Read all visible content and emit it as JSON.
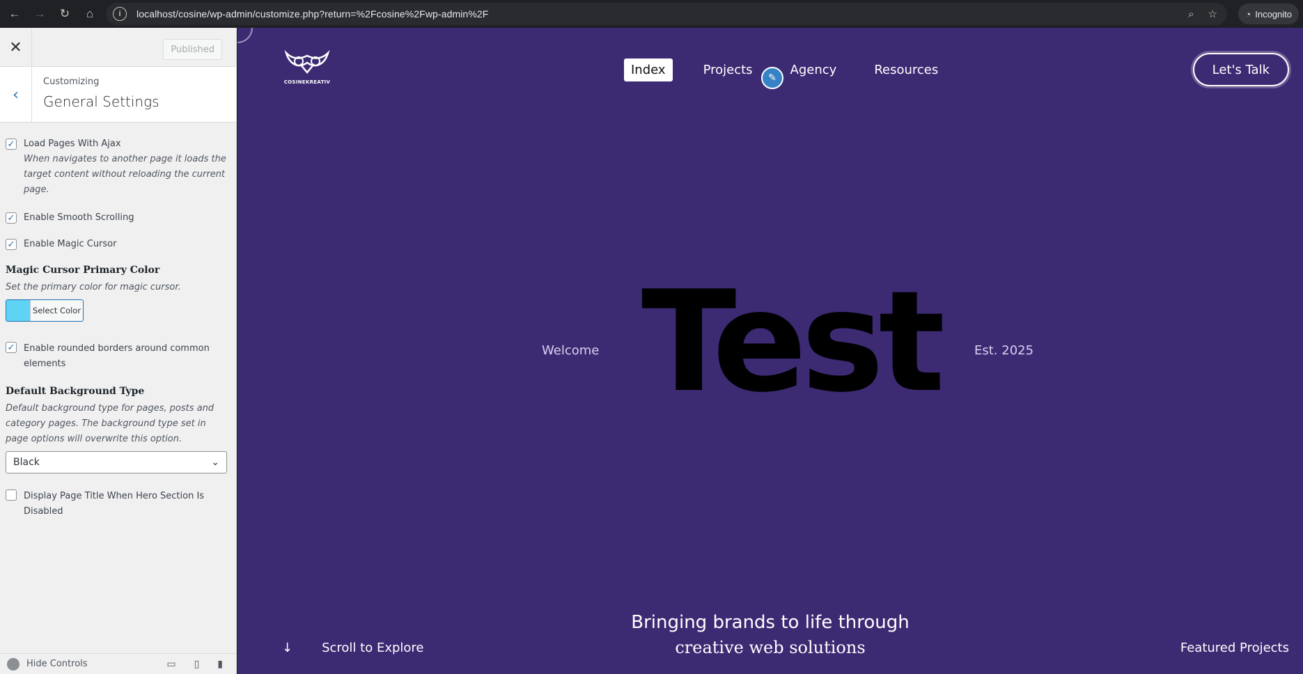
{
  "browser": {
    "url": "localhost/cosine/wp-admin/customize.php?return=%2Fcosine%2Fwp-admin%2F",
    "incognito_label": "Incognito"
  },
  "customizer": {
    "published_label": "Published",
    "customizing_label": "Customizing",
    "section_title": "General Settings",
    "options": {
      "ajax_label": "Load Pages With Ajax",
      "ajax_desc": "When navigates to another page it loads the target content without reloading the current page.",
      "smooth_label": "Enable Smooth Scrolling",
      "cursor_label": "Enable Magic Cursor",
      "cursor_color_heading": "Magic Cursor Primary Color",
      "cursor_color_desc": "Set the primary color for magic cursor.",
      "select_color_label": "Select Color",
      "cursor_color_value": "#5ed3f3",
      "rounded_label": "Enable rounded borders around common elements",
      "bg_heading": "Default Background Type",
      "bg_desc": "Default background type for pages, posts and category pages. The background type set in page options will overwrite this option.",
      "bg_value": "Black",
      "page_title_label": "Display Page Title When Hero Section Is Disabled"
    },
    "footer": {
      "hide_controls_label": "Hide Controls"
    }
  },
  "site": {
    "logo_text": "COSINEKREATIV",
    "nav": [
      "Index",
      "Projects",
      "Agency",
      "Resources"
    ],
    "cta_label": "Let's Talk",
    "hero_left": "Welcome",
    "hero_title": "Test",
    "hero_right": "Est. 2025",
    "tagline_line1": "Bringing brands to life through",
    "tagline_line2": "creative web solutions",
    "scroll_label": "Scroll to Explore",
    "featured_label": "Featured Projects",
    "bg_color": "#3c2a73"
  }
}
